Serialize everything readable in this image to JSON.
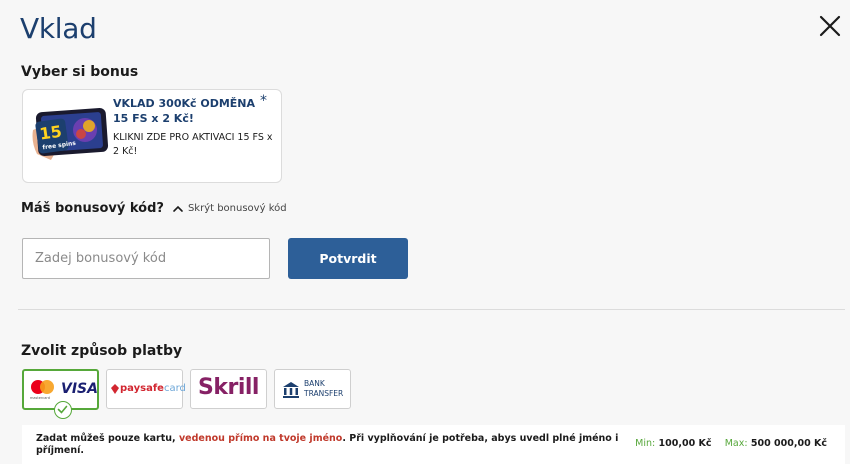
{
  "header": {
    "title": "Vklad"
  },
  "bonus": {
    "section_label": "Vyber si bonus",
    "card": {
      "title": "VKLAD 300Kč ODMĚNA 15 FS x 2 Kč!",
      "star": "*",
      "subtitle": "KLIKNI ZDE PRO AKTIVACI 15 FS x 2 Kč!",
      "thumb_badge_number": "15",
      "thumb_badge_text": "free spins"
    }
  },
  "promo": {
    "question": "Máš bonusový kód?",
    "toggle_label": "Skrýt bonusový kód",
    "input_placeholder": "Zadej bonusový kód",
    "input_value": "",
    "confirm_label": "Potvrdit"
  },
  "payment": {
    "section_label": "Zvolit způsob platby",
    "methods": [
      {
        "name": "Mastercard / VISA",
        "visa_text": "VISA",
        "mc_text": "mastercard",
        "selected": true
      },
      {
        "name": "paysafecard",
        "text_a": "paysafe",
        "text_b": "card"
      },
      {
        "name": "Skrill",
        "text": "Skrill"
      },
      {
        "name": "Bank transfer",
        "line1": "BANK",
        "line2": "TRANSFER"
      }
    ],
    "info_prefix": "Zadat můžeš pouze kartu, ",
    "info_highlight": "vedenou přímo na tvoje jméno",
    "info_suffix": ". Při vyplňování je potřeba, abys uvedl plné jméno i příjmení.",
    "min_label": "Min:",
    "min_value": "100,00 Kč",
    "max_label": "Max:",
    "max_value": "500 000,00 Kč"
  },
  "colors": {
    "title": "#1c3f6e",
    "button": "#2d5f98",
    "selected_border": "#56a83a",
    "skrill": "#862165",
    "paysafe": "#d22630",
    "highlight_red": "#c0392b"
  }
}
